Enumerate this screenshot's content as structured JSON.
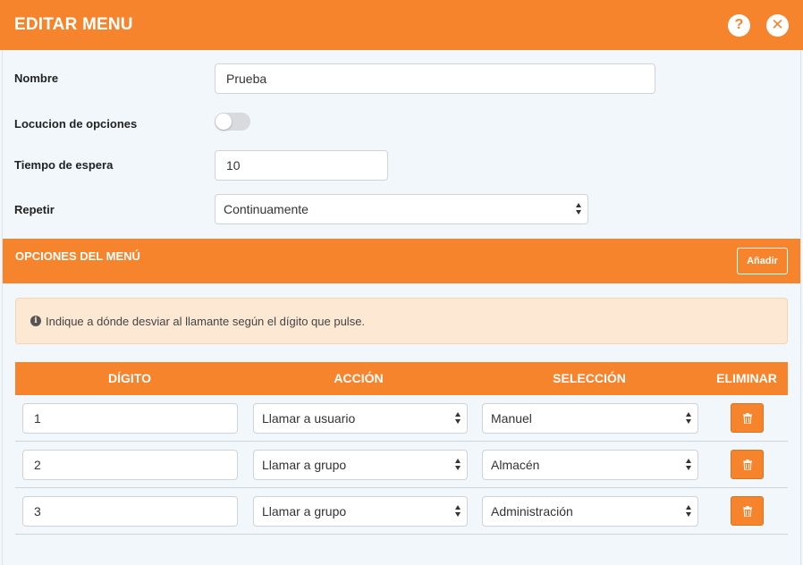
{
  "header": {
    "title": "EDITAR MENU",
    "help_icon": "question-circle-icon",
    "close_icon": "times-circle-icon"
  },
  "form": {
    "nombre_label": "Nombre",
    "nombre_value": "Prueba",
    "locucion_label": "Locucion de opciones",
    "locucion_enabled": false,
    "tiempo_label": "Tiempo de espera",
    "tiempo_value": "10",
    "repetir_label": "Repetir",
    "repetir_value": "Continuamente"
  },
  "section": {
    "title": "OPCIONES DEL MENÚ",
    "add_label": "Añadir"
  },
  "alert": {
    "icon": "info-circle-icon",
    "text": "Indique a dónde desviar al llamante según el dígito que pulse."
  },
  "table": {
    "headers": [
      "DÍGITO",
      "ACCIÓN",
      "SELECCIÓN",
      "ELIMINAR"
    ],
    "rows": [
      {
        "digito": "1",
        "accion": "Llamar a usuario",
        "seleccion": "Manuel"
      },
      {
        "digito": "2",
        "accion": "Llamar a grupo",
        "seleccion": "Almacén"
      },
      {
        "digito": "3",
        "accion": "Llamar a grupo",
        "seleccion": "Administración"
      }
    ]
  },
  "colors": {
    "accent": "#f5842c",
    "background": "#f1f7fb",
    "alert_bg": "#fde8d3"
  }
}
